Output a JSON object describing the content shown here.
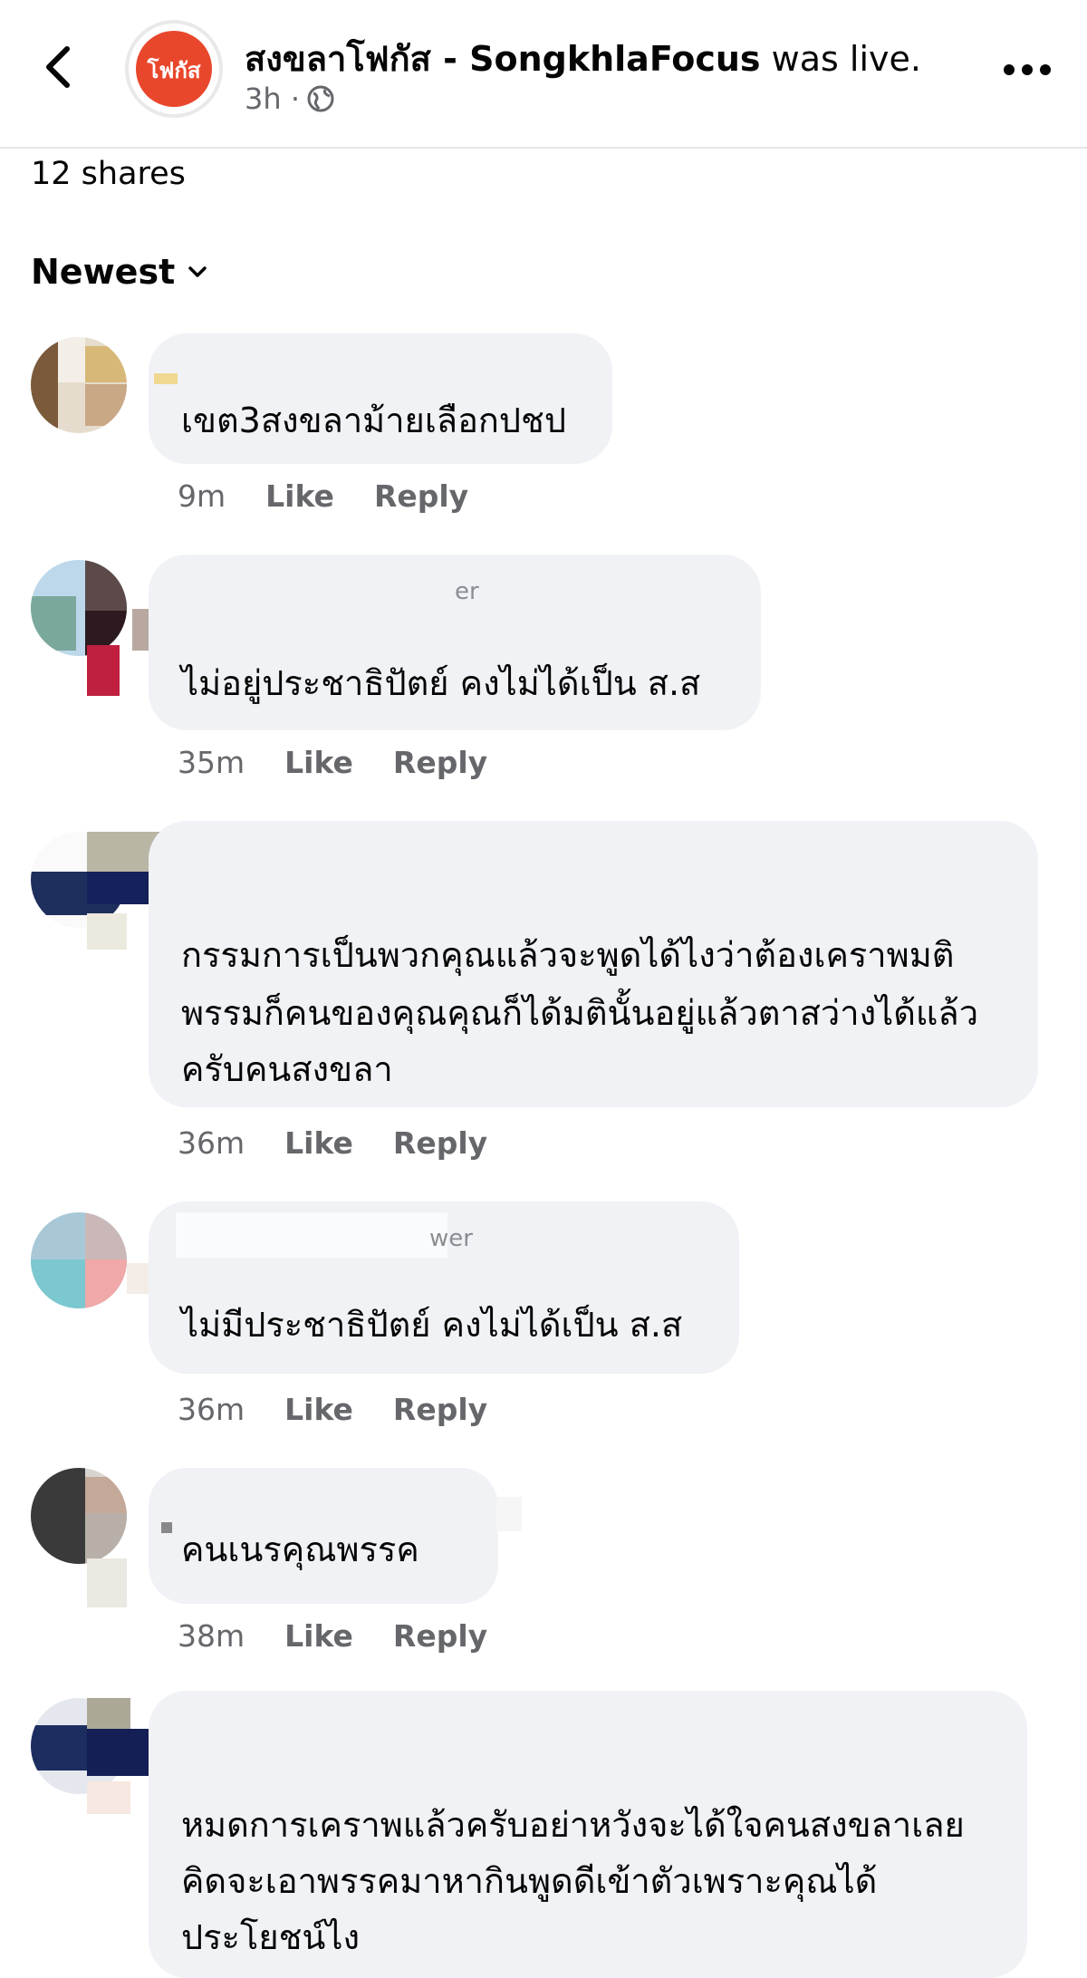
{
  "header": {
    "page_name": "สงขลาโฟกัส - SongkhlaFocus",
    "status": "was live.",
    "time": "3h ·",
    "logo_text": "โฟกัส",
    "back_icon": "chevron-left-icon",
    "privacy_icon": "globe-icon",
    "more_icon": "ellipsis-icon"
  },
  "shares": "12 shares",
  "sort": {
    "label": "Newest",
    "icon": "chevron-down-icon"
  },
  "actions": {
    "like": "Like",
    "reply": "Reply"
  },
  "colors": {
    "accent": "#e9472c",
    "bubble": "#f0f2f5",
    "muted": "#65676b"
  },
  "comments": [
    {
      "author": "",
      "lines": [
        "เขต3สงขลาม้ายเลือกปชป"
      ],
      "time": "9m"
    },
    {
      "author": "er",
      "lines": [
        "ไม่อยู่ประชาธิปัตย์  คงไม่ได้เป็น ส.ส"
      ],
      "time": "35m"
    },
    {
      "author": "",
      "lines": [
        "กรรมการเป็นพวกคุณแล้วจะพูดได้ไงว่าต้องเคราพมติ",
        "พรรมก็คนของคุณคุณก็ได้มตินั้นอยู่แล้วตาสว่างได้แล้ว",
        "ครับคนสงขลา"
      ],
      "time": "36m"
    },
    {
      "author": "wer",
      "lines": [
        "ไม่มีประชาธิปัตย์  คงไม่ได้เป็น ส.ส"
      ],
      "time": "36m"
    },
    {
      "author": "",
      "lines": [
        "คนเนรคุณพรรค"
      ],
      "time": "38m"
    },
    {
      "author": "",
      "lines": [
        "หมดการเคราพแล้วครับอย่าหวังจะได้ใจคนสงขลาเลย",
        "คิดจะเอาพรรคมาหากินพูดดีเข้าตัวเพราะคุณได้",
        "ประโยชน์ไง"
      ],
      "time": ""
    }
  ]
}
